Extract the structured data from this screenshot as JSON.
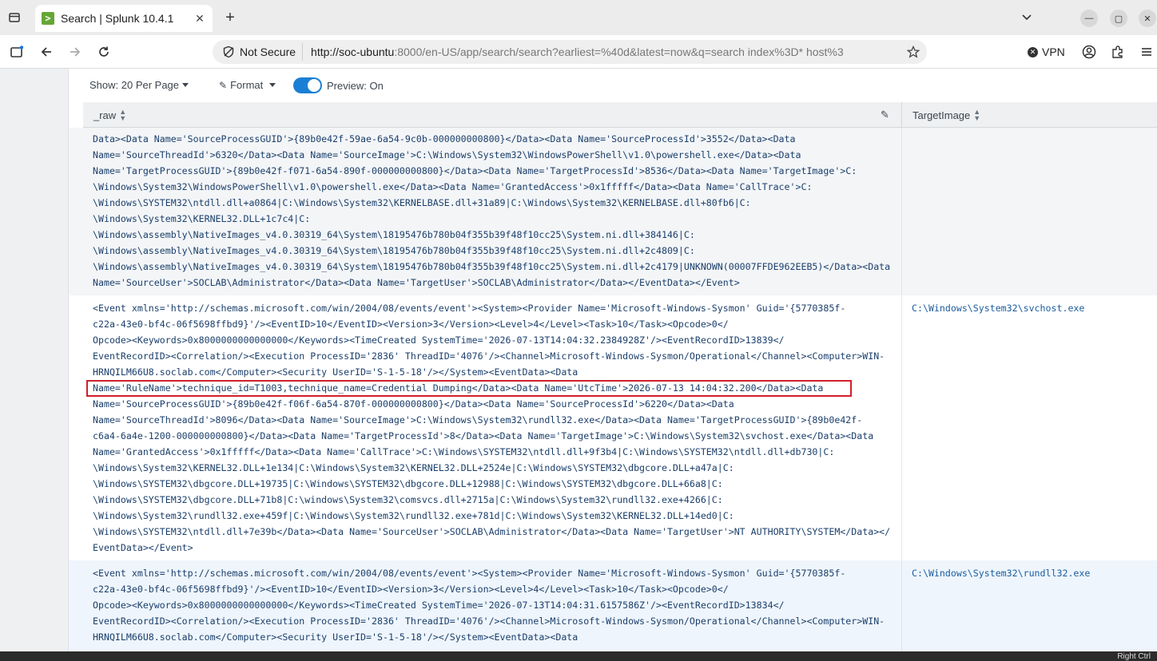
{
  "browser": {
    "tab_title": "Search | Splunk 10.4.1",
    "favicon_glyph": ">",
    "security_label": "Not Secure",
    "url_host": "http://soc-ubuntu",
    "url_rest": ":8000/en-US/app/search/search?earliest=%40d&latest=now&q=search index%3D* host%3",
    "vpn_label": "VPN"
  },
  "toolbar": {
    "per_page_label": "Show: 20 Per Page",
    "format_label": "Format",
    "preview_label": "Preview: On"
  },
  "table": {
    "columns": [
      "_raw",
      "TargetImage"
    ],
    "rows": [
      {
        "raw_lines": [
          "Data><Data Name='SourceProcessGUID'>{89b0e42f-59ae-6a54-9c0b-000000000800}</Data><Data Name='SourceProcessId'>3552</Data><Data",
          "Name='SourceThreadId'>6320</Data><Data Name='SourceImage'>C:\\Windows\\System32\\WindowsPowerShell\\v1.0\\powershell.exe</Data><Data",
          "Name='TargetProcessGUID'>{89b0e42f-f071-6a54-890f-000000000800}</Data><Data Name='TargetProcessId'>8536</Data><Data Name='TargetImage'>C:",
          "\\Windows\\System32\\WindowsPowerShell\\v1.0\\powershell.exe</Data><Data Name='GrantedAccess'>0x1fffff</Data><Data Name='CallTrace'>C:",
          "\\Windows\\SYSTEM32\\ntdll.dll+a0864|C:\\Windows\\System32\\KERNELBASE.dll+31a89|C:\\Windows\\System32\\KERNELBASE.dll+80fb6|C:",
          "\\Windows\\System32\\KERNEL32.DLL+1c7c4|C:",
          "\\Windows\\assembly\\NativeImages_v4.0.30319_64\\System\\18195476b780b04f355b39f48f10cc25\\System.ni.dll+384146|C:",
          "\\Windows\\assembly\\NativeImages_v4.0.30319_64\\System\\18195476b780b04f355b39f48f10cc25\\System.ni.dll+2c4809|C:",
          "\\Windows\\assembly\\NativeImages_v4.0.30319_64\\System\\18195476b780b04f355b39f48f10cc25\\System.ni.dll+2c4179|UNKNOWN(00007FFDE962EEB5)</Data><Data",
          "Name='SourceUser'>SOCLAB\\Administrator</Data><Data Name='TargetUser'>SOCLAB\\Administrator</Data></EventData></Event>"
        ],
        "target": ""
      },
      {
        "raw_lines": [
          "<Event xmlns='http://schemas.microsoft.com/win/2004/08/events/event'><System><Provider Name='Microsoft-Windows-Sysmon' Guid='{5770385f-",
          "c22a-43e0-bf4c-06f5698ffbd9}'/><EventID>10</EventID><Version>3</Version><Level>4</Level><Task>10</Task><Opcode>0</",
          "Opcode><Keywords>0x8000000000000000</Keywords><TimeCreated SystemTime='2026-07-13T14:04:32.2384928Z'/><EventRecordID>13839</",
          "EventRecordID><Correlation/><Execution ProcessID='2836' ThreadID='4076'/><Channel>Microsoft-Windows-Sysmon/Operational</Channel><Computer>WIN-",
          "HRNQILM66U8.soclab.com</Computer><Security UserID='S-1-5-18'/></System><EventData><Data",
          "Name='RuleName'>technique_id=T1003,technique_name=Credential Dumping</Data><Data Name='UtcTime'>2026-07-13 14:04:32.200</Data><Data",
          "Name='SourceProcessGUID'>{89b0e42f-f06f-6a54-870f-000000000800}</Data><Data Name='SourceProcessId'>6220</Data><Data",
          "Name='SourceThreadId'>8096</Data><Data Name='SourceImage'>C:\\Windows\\System32\\rundll32.exe</Data><Data Name='TargetProcessGUID'>{89b0e42f-",
          "c6a4-6a4e-1200-000000000800}</Data><Data Name='TargetProcessId'>8</Data><Data Name='TargetImage'>C:\\Windows\\System32\\svchost.exe</Data><Data",
          "Name='GrantedAccess'>0x1fffff</Data><Data Name='CallTrace'>C:\\Windows\\SYSTEM32\\ntdll.dll+9f3b4|C:\\Windows\\SYSTEM32\\ntdll.dll+db730|C:",
          "\\Windows\\System32\\KERNEL32.DLL+1e134|C:\\Windows\\System32\\KERNEL32.DLL+2524e|C:\\Windows\\SYSTEM32\\dbgcore.DLL+a47a|C:",
          "\\Windows\\SYSTEM32\\dbgcore.DLL+19735|C:\\Windows\\SYSTEM32\\dbgcore.DLL+12988|C:\\Windows\\SYSTEM32\\dbgcore.DLL+66a8|C:",
          "\\Windows\\SYSTEM32\\dbgcore.DLL+71b8|C:\\windows\\System32\\comsvcs.dll+2715a|C:\\Windows\\System32\\rundll32.exe+4266|C:",
          "\\Windows\\System32\\rundll32.exe+459f|C:\\Windows\\System32\\rundll32.exe+781d|C:\\Windows\\System32\\KERNEL32.DLL+14ed0|C:",
          "\\Windows\\SYSTEM32\\ntdll.dll+7e39b</Data><Data Name='SourceUser'>SOCLAB\\Administrator</Data><Data Name='TargetUser'>NT AUTHORITY\\SYSTEM</Data></",
          "EventData></Event>"
        ],
        "target": "C:\\Windows\\System32\\svchost.exe"
      },
      {
        "raw_lines": [
          "<Event xmlns='http://schemas.microsoft.com/win/2004/08/events/event'><System><Provider Name='Microsoft-Windows-Sysmon' Guid='{5770385f-",
          "c22a-43e0-bf4c-06f5698ffbd9}'/><EventID>10</EventID><Version>3</Version><Level>4</Level><Task>10</Task><Opcode>0</",
          "Opcode><Keywords>0x8000000000000000</Keywords><TimeCreated SystemTime='2026-07-13T14:04:31.6157586Z'/><EventRecordID>13834</",
          "EventRecordID><Correlation/><Execution ProcessID='2836' ThreadID='4076'/><Channel>Microsoft-Windows-Sysmon/Operational</Channel><Computer>WIN-",
          "HRNQILM66U8.soclab.com</Computer><Security UserID='S-1-5-18'/></System><EventData><Data"
        ],
        "target": "C:\\Windows\\System32\\rundll32.exe"
      }
    ]
  },
  "taskbar": {
    "tray_text": "Right Ctrl"
  },
  "colors": {
    "accent": "#1a7fd4",
    "highlight_border": "#d0202a",
    "splunk_green": "#65a637"
  }
}
